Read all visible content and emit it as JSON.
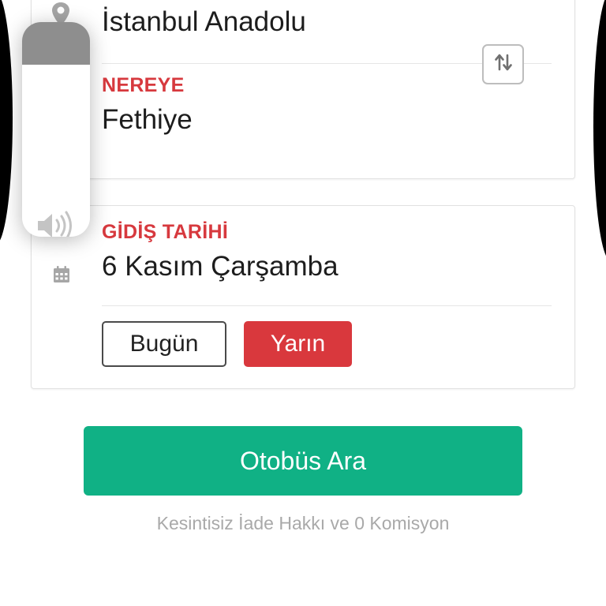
{
  "route": {
    "from_value": "İstanbul Anadolu",
    "to_label": "NEREYE",
    "to_value": "Fethiye"
  },
  "date": {
    "label": "GİDİŞ TARİHİ",
    "value": "6 Kasım Çarşamba",
    "today_label": "Bugün",
    "tomorrow_label": "Yarın"
  },
  "search": {
    "button_label": "Otobüs Ara",
    "tagline": "Kesintisiz İade Hakkı ve 0 Komisyon"
  },
  "volume": {
    "level_fraction": 0.8,
    "icon": "speaker-icon"
  },
  "colors": {
    "accent_red": "#d9383d",
    "primary_green": "#10b185",
    "label_red": "#d7393e",
    "icon_gray": "#a6a6a6"
  },
  "icons": {
    "location": "location-pin-icon",
    "swap": "swap-arrows-icon",
    "calendar": "calendar-icon"
  }
}
